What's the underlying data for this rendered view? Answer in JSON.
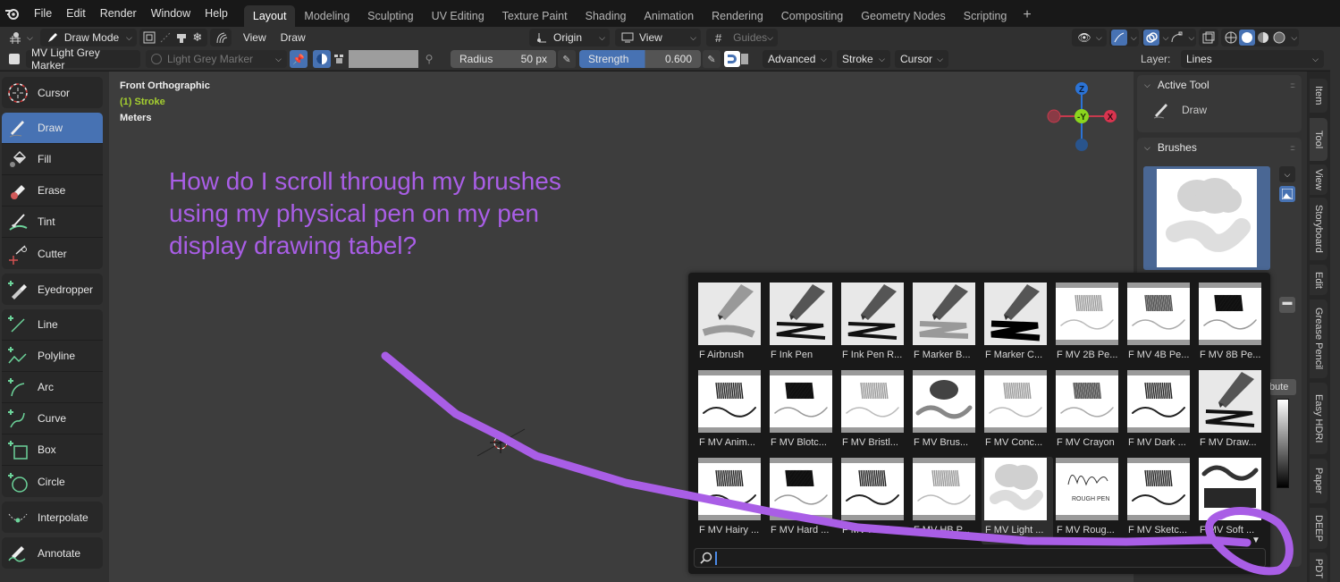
{
  "menubar": {
    "menus": [
      "File",
      "Edit",
      "Render",
      "Window",
      "Help"
    ],
    "workspaces": [
      "Layout",
      "Modeling",
      "Sculpting",
      "UV Editing",
      "Texture Paint",
      "Shading",
      "Animation",
      "Rendering",
      "Compositing",
      "Geometry Nodes",
      "Scripting"
    ],
    "active_workspace": "Layout",
    "add_workspace": "+"
  },
  "header": {
    "mode": "Draw Mode",
    "menu_view": "View",
    "menu_draw": "Draw",
    "origin": "Origin",
    "view_orient": "View",
    "guides": "Guides"
  },
  "toolsettings": {
    "brush_name": "MV Light Grey Marker",
    "material": "Light Grey Marker",
    "radius_label": "Radius",
    "radius_value": "50 px",
    "strength_label": "Strength",
    "strength_value": "0.600",
    "strength_fraction": 0.6,
    "advanced": "Advanced",
    "stroke": "Stroke",
    "cursor": "Cursor",
    "layer_label": "Layer:",
    "layer_value": "Lines"
  },
  "toolbar": {
    "groups": [
      [
        {
          "label": "Cursor",
          "icon": "cursor-icon"
        }
      ],
      [
        {
          "label": "Draw",
          "icon": "draw-icon",
          "active": true
        },
        {
          "label": "Fill",
          "icon": "fill-icon"
        },
        {
          "label": "Erase",
          "icon": "erase-icon"
        },
        {
          "label": "Tint",
          "icon": "tint-icon"
        },
        {
          "label": "Cutter",
          "icon": "cutter-icon"
        }
      ],
      [
        {
          "label": "Eyedropper",
          "icon": "eyedropper-icon"
        }
      ],
      [
        {
          "label": "Line",
          "icon": "line-icon"
        },
        {
          "label": "Polyline",
          "icon": "polyline-icon"
        },
        {
          "label": "Arc",
          "icon": "arc-icon"
        },
        {
          "label": "Curve",
          "icon": "curve-icon"
        },
        {
          "label": "Box",
          "icon": "box-icon"
        },
        {
          "label": "Circle",
          "icon": "circle-icon"
        }
      ],
      [
        {
          "label": "Interpolate",
          "icon": "interpolate-icon"
        }
      ],
      [
        {
          "label": "Annotate",
          "icon": "annotate-icon"
        }
      ]
    ]
  },
  "viewport": {
    "view_name": "Front Orthographic",
    "object_info": "(1) Stroke",
    "units": "Meters",
    "annotation_text": "How do I scroll through my brushes using my physical pen on my pen display drawing tabel?",
    "annotation_color": "#a95ee6",
    "gizmo": {
      "z": "Z",
      "y": "-Y",
      "x": "X"
    }
  },
  "npanel": {
    "active_tool_title": "Active Tool",
    "active_tool_name": "Draw",
    "brushes_title": "Brushes",
    "partial_button": "bute"
  },
  "sidetabs": [
    "Item",
    "Tool",
    "View",
    "Storyboard",
    "Edit",
    "Grease Pencil",
    "Easy HDRI",
    "Paper",
    "DEEP",
    "PDT"
  ],
  "brush_popup": {
    "brushes": [
      {
        "label": "F Airbrush",
        "kind": "pen-airbrush"
      },
      {
        "label": "F Ink Pen",
        "kind": "pen-ink"
      },
      {
        "label": "F Ink Pen R...",
        "kind": "pen-ink"
      },
      {
        "label": "F Marker B...",
        "kind": "pen-marker"
      },
      {
        "label": "F Marker C...",
        "kind": "pen-chisel"
      },
      {
        "label": "F MV 2B Pe...",
        "kind": "pencil-light"
      },
      {
        "label": "F MV 4B Pe...",
        "kind": "pencil-mid"
      },
      {
        "label": "F MV 8B Pe...",
        "kind": "pencil-dark"
      },
      {
        "label": "F MV Anim...",
        "kind": "scribble"
      },
      {
        "label": "F MV Blotc...",
        "kind": "pencil-dark"
      },
      {
        "label": "F MV Bristl...",
        "kind": "pencil-light"
      },
      {
        "label": "F MV Brus...",
        "kind": "blob"
      },
      {
        "label": "F MV Conc...",
        "kind": "pencil-light"
      },
      {
        "label": "F MV Crayon",
        "kind": "pencil-mid"
      },
      {
        "label": "F MV Dark ...",
        "kind": "scribble"
      },
      {
        "label": "F MV Draw...",
        "kind": "pen-ink"
      },
      {
        "label": "F MV Hairy ...",
        "kind": "scribble"
      },
      {
        "label": "F MV Hard ...",
        "kind": "pencil-dark"
      },
      {
        "label": "F MV Hard...",
        "kind": "scribble"
      },
      {
        "label": "F MV HB P...",
        "kind": "pencil-light"
      },
      {
        "label": "F MV Light ...",
        "kind": "light-marker",
        "selected": true
      },
      {
        "label": "F MV Roug...",
        "kind": "rough-pen"
      },
      {
        "label": "F MV Sketc...",
        "kind": "scribble"
      },
      {
        "label": "F MV Soft ...",
        "kind": "soft"
      }
    ],
    "search_value": ""
  }
}
